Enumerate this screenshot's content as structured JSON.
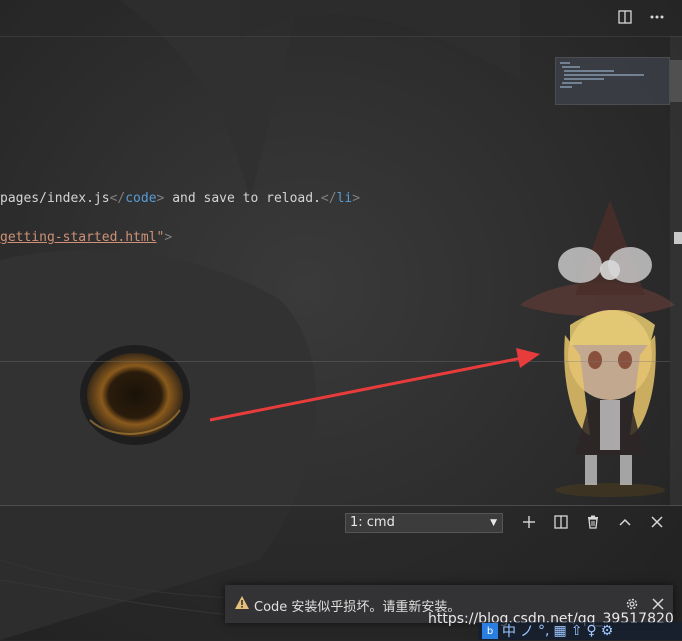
{
  "editor": {
    "split_icon": "split-editor-icon",
    "more_icon": "more-actions-icon",
    "code_lines": {
      "line1": {
        "text1": "pages/index.js",
        "tag_open": "</",
        "tagname": "code",
        "tag_close": ">",
        "text2": " and save to reload.",
        "tag2_open": "</",
        "tagname2": "li",
        "tag2_close": ">"
      },
      "line2": {
        "string": "getting-started.html",
        "quote": "\"",
        "tag_close": ">"
      }
    }
  },
  "terminal": {
    "selected": "1: cmd",
    "icons": [
      "plus-icon",
      "split-terminal-icon",
      "trash-icon",
      "chevron-up-icon",
      "close-icon"
    ]
  },
  "notification": {
    "message": "Code 安装似乎损坏。请重新安装。",
    "icons": [
      "warning-icon",
      "gear-icon",
      "close-icon"
    ],
    "warning_color": "#e5c07b"
  },
  "watermark": "https://blog.csdn.net/qq_39517820",
  "ime": {
    "logo": "b",
    "items": [
      "中",
      "ノ",
      "°,",
      "▦",
      "⇧",
      "♀",
      "⚙"
    ]
  },
  "colors": {
    "arrow": "#e83c3c"
  }
}
